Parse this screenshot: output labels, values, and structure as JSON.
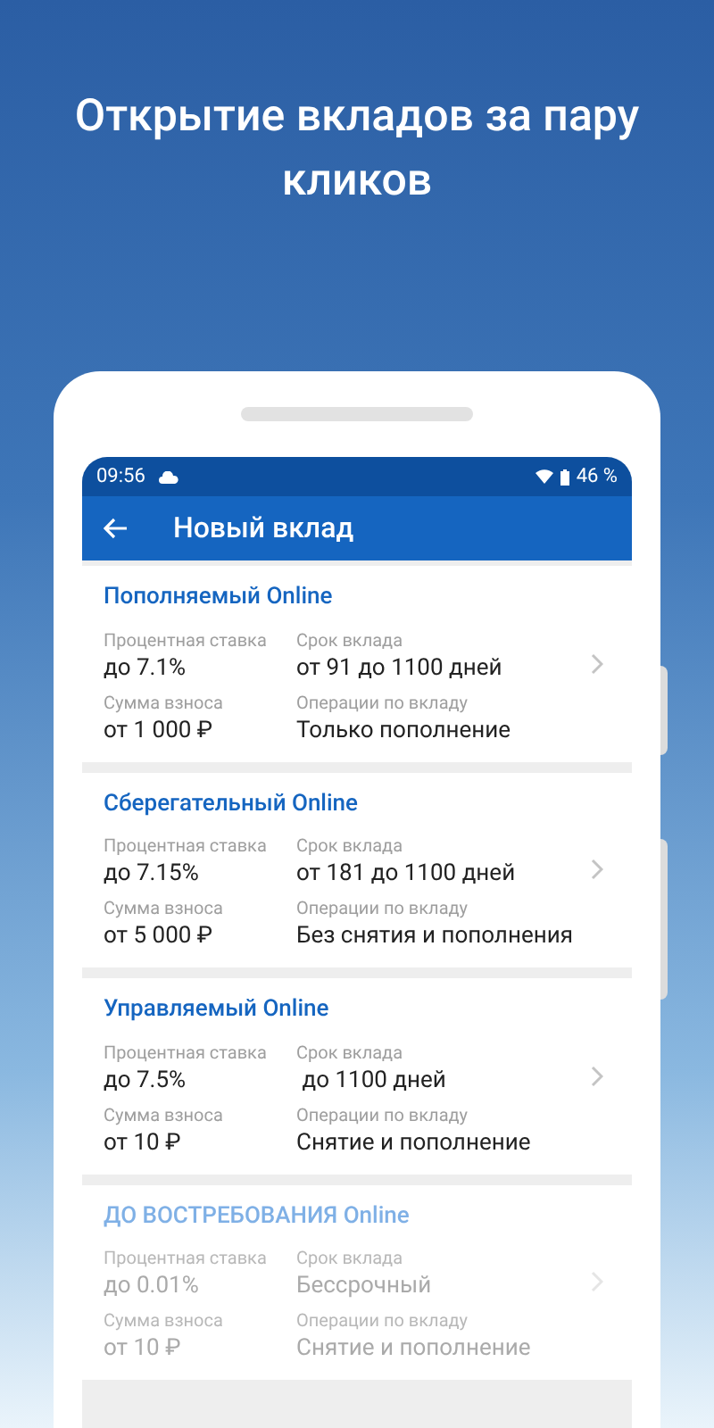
{
  "headline": "Открытие вкладов за пару кликов",
  "status_bar": {
    "time": "09:56",
    "battery": "46 %"
  },
  "app_bar": {
    "title": "Новый вклад"
  },
  "deposits": [
    {
      "name": "Пополняемый Online",
      "disabled": false,
      "rate_label": "Процентная ставка",
      "rate": "до 7.1%",
      "term_label": "Срок вклада",
      "term": "от 91 до 1100 дней",
      "amount_label": "Сумма взноса",
      "amount": "от 1 000 ₽",
      "ops_label": "Операции по вкладу",
      "ops": "Только пополнение"
    },
    {
      "name": "Сберегательный Online",
      "disabled": false,
      "rate_label": "Процентная ставка",
      "rate": "до 7.15%",
      "term_label": "Срок вклада",
      "term": "от 181 до 1100 дней",
      "amount_label": "Сумма взноса",
      "amount": "от 5 000 ₽",
      "ops_label": "Операции по вкладу",
      "ops": "Без снятия и пополнения"
    },
    {
      "name": "Управляемый Online",
      "disabled": false,
      "rate_label": "Процентная ставка",
      "rate": "до 7.5%",
      "term_label": "Срок вклада",
      "term": " до 1100 дней",
      "amount_label": "Сумма взноса",
      "amount": "от 10 ₽",
      "ops_label": "Операции по вкладу",
      "ops": "Снятие и пополнение"
    },
    {
      "name": "ДО ВОСТРЕБОВАНИЯ Online",
      "disabled": true,
      "rate_label": "Процентная ставка",
      "rate": "до 0.01%",
      "term_label": "Срок вклада",
      "term": "Бессрочный",
      "amount_label": "Сумма взноса",
      "amount": "от 10 ₽",
      "ops_label": "Операции по вкладу",
      "ops": "Снятие и пополнение"
    }
  ]
}
